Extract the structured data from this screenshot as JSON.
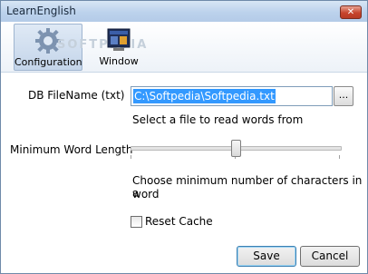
{
  "window": {
    "title": "LearnEnglish"
  },
  "toolbar": {
    "items": [
      {
        "label": "Configuration",
        "icon": "gear-icon",
        "active": true
      },
      {
        "label": "Window",
        "icon": "window-icon",
        "active": false
      }
    ],
    "watermark": "SOFTPEDIA"
  },
  "form": {
    "db_label": "DB FileName (txt)",
    "db_value": "C:\\Softpedia\\Softpedia.txt",
    "browse_label": "...",
    "db_hint": "Select a file to read words from",
    "min_label": "Minimum Word Length",
    "min_hint_line1": "Choose minimum number of characters in a",
    "min_hint_line2": "word",
    "slider_fraction": 0.5,
    "reset_label": "Reset Cache",
    "reset_checked": false
  },
  "buttons": {
    "save": "Save",
    "cancel": "Cancel"
  },
  "colors": {
    "selection": "#3399ff",
    "titlebar": "#bcd2ec"
  }
}
